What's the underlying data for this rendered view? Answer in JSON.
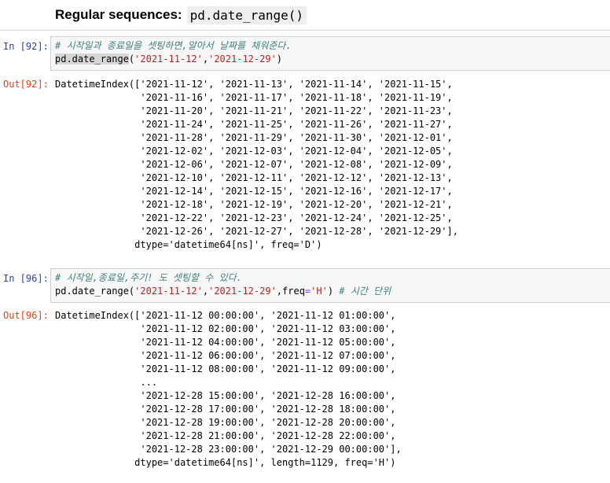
{
  "heading": {
    "label": "Regular sequences:",
    "code": "pd.date_range()"
  },
  "cell1": {
    "in_prompt": "In [92]:",
    "comment": "# 시작일과 종료일을 셋팅하면,알아서 날짜를 채워준다.",
    "fn": "pd.date_range",
    "open": "(",
    "arg1": "'2021-11-12'",
    "sep": ",",
    "arg2": "'2021-12-29'",
    "close": ")",
    "out_prompt": "Out[92]:",
    "output": "DatetimeIndex(['2021-11-12', '2021-11-13', '2021-11-14', '2021-11-15',\n               '2021-11-16', '2021-11-17', '2021-11-18', '2021-11-19',\n               '2021-11-20', '2021-11-21', '2021-11-22', '2021-11-23',\n               '2021-11-24', '2021-11-25', '2021-11-26', '2021-11-27',\n               '2021-11-28', '2021-11-29', '2021-11-30', '2021-12-01',\n               '2021-12-02', '2021-12-03', '2021-12-04', '2021-12-05',\n               '2021-12-06', '2021-12-07', '2021-12-08', '2021-12-09',\n               '2021-12-10', '2021-12-11', '2021-12-12', '2021-12-13',\n               '2021-12-14', '2021-12-15', '2021-12-16', '2021-12-17',\n               '2021-12-18', '2021-12-19', '2021-12-20', '2021-12-21',\n               '2021-12-22', '2021-12-23', '2021-12-24', '2021-12-25',\n               '2021-12-26', '2021-12-27', '2021-12-28', '2021-12-29'],\n              dtype='datetime64[ns]', freq='D')"
  },
  "cell2": {
    "in_prompt": "In [96]:",
    "comment": "# 시작일,종료일,주기! 도 셋팅할 수 있다.",
    "fn": "pd.date_range(",
    "arg1": "'2021-11-12'",
    "sep": ",",
    "arg2": "'2021-12-29'",
    "kw": ",freq",
    "eq": "=",
    "arg3": "'H'",
    "close": ") ",
    "comment2": "# 시간 단위",
    "out_prompt": "Out[96]:",
    "output": "DatetimeIndex(['2021-11-12 00:00:00', '2021-11-12 01:00:00',\n               '2021-11-12 02:00:00', '2021-11-12 03:00:00',\n               '2021-11-12 04:00:00', '2021-11-12 05:00:00',\n               '2021-11-12 06:00:00', '2021-11-12 07:00:00',\n               '2021-11-12 08:00:00', '2021-11-12 09:00:00',\n               ...\n               '2021-12-28 15:00:00', '2021-12-28 16:00:00',\n               '2021-12-28 17:00:00', '2021-12-28 18:00:00',\n               '2021-12-28 19:00:00', '2021-12-28 20:00:00',\n               '2021-12-28 21:00:00', '2021-12-28 22:00:00',\n               '2021-12-28 23:00:00', '2021-12-29 00:00:00'],\n              dtype='datetime64[ns]', length=1129, freq='H')"
  }
}
